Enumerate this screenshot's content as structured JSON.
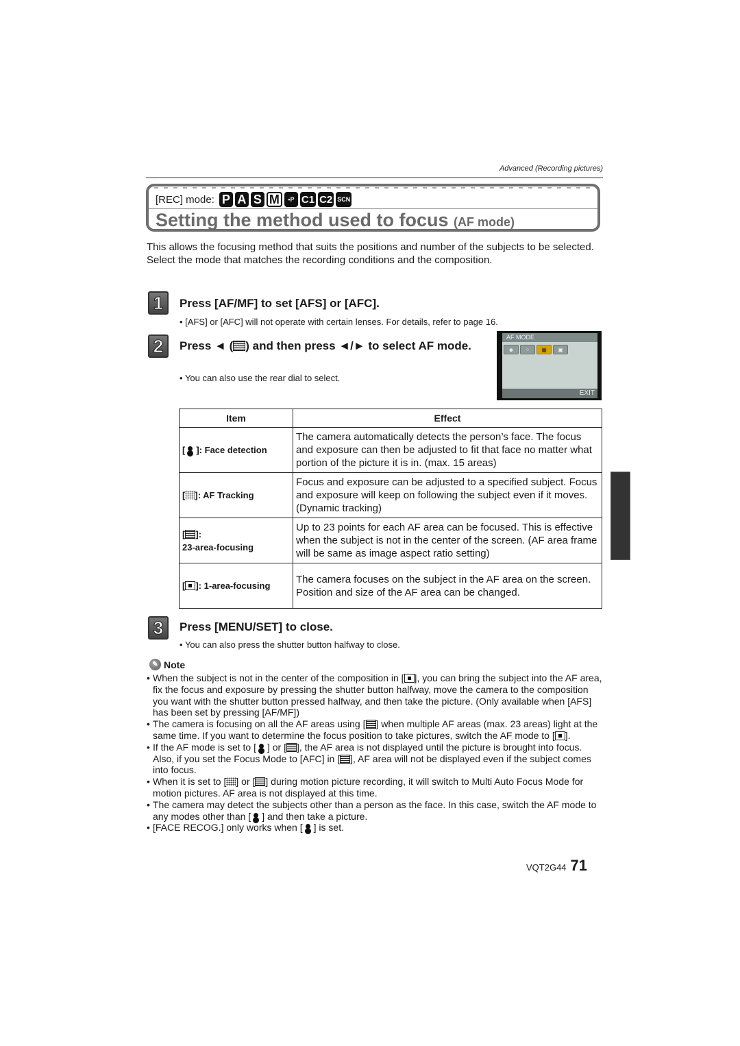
{
  "header": {
    "section_label": "Advanced (Recording pictures)"
  },
  "title_box": {
    "rec_mode_label": "[REC] mode:",
    "rec_modes": [
      "P",
      "A",
      "S",
      "M",
      "movie-P",
      "C1",
      "C2",
      "SCN"
    ],
    "title": "Setting the method used to focus",
    "title_sub": "(AF mode)"
  },
  "intro": {
    "paragraph_1": "This allows the focusing method that suits the positions and number of the subjects to be selected.",
    "paragraph_2": "Select the mode that matches the recording conditions and the composition."
  },
  "steps": [
    {
      "number": "1",
      "heading": "Press [AF/MF] to set [AFS] or [AFC].",
      "bullet": "[AFS] or [AFC] will not operate with certain lenses. For details, refer to page 16."
    },
    {
      "number": "2",
      "heading_part1": "Press ◄ (",
      "heading_icon": "af-mode-icon",
      "heading_part2": ") and then press ◄/► to select AF mode.",
      "bullet": "You can also use the rear dial to select."
    },
    {
      "number": "3",
      "heading": "Press [MENU/SET] to close.",
      "bullet": "You can also press the shutter button halfway to close."
    }
  ],
  "camera_screen": {
    "title": "AF MODE",
    "icons": [
      "face-detection",
      "af-tracking",
      "23-area-focusing",
      "1-area-focusing"
    ],
    "selected_index": 2,
    "exit_label": "EXIT"
  },
  "table": {
    "headers": [
      "Item",
      "Effect"
    ],
    "rows": [
      {
        "icon": "face-detection-icon",
        "item": ": Face detection",
        "effect": "The camera automatically detects the person’s face. The focus and exposure can then be adjusted to fit that face no matter what portion of the picture it is in. (max. 15 areas)"
      },
      {
        "icon": "af-tracking-icon",
        "item": ": AF Tracking",
        "effect": "Focus and exposure can be adjusted to a specified subject. Focus and exposure will keep on following the subject even if it moves. (Dynamic tracking)"
      },
      {
        "icon": "23-area-icon",
        "item": ":",
        "item_line2": "23-area-focusing",
        "effect": "Up to 23 points for each AF area can be focused. This is effective when the subject is not in the center of the screen. (AF area frame will be same as image aspect ratio setting)"
      },
      {
        "icon": "1-area-icon",
        "item": ": 1-area-focusing",
        "effect_line1": "The camera focuses on the subject in the AF area on the screen.",
        "effect_line2": "Position and size of the AF area can be changed."
      }
    ]
  },
  "note": {
    "heading": "Note",
    "items": [
      {
        "parts": [
          "When the subject is not in the center of the composition in [",
          "]",
          ", you can bring the subject into the AF area, fix the focus and exposure by pressing the shutter button halfway, move the camera to the composition you want with the shutter button pressed halfway, and then take the picture. (Only available when [AFS] has been set by pressing [AF/MF])"
        ]
      },
      {
        "parts": [
          "The camera is focusing on all the AF areas using [",
          "] when multiple AF areas (max. 23 areas) light at the same time. If you want to determine the focus position to take pictures, switch the AF mode to [",
          "]."
        ]
      },
      {
        "parts": [
          "If the AF mode is set to [",
          "] or [",
          "], the AF area is not displayed until the picture is brought into focus. Also, if you set the Focus Mode to [AFC] in [",
          "], AF area will not be displayed even if the subject comes into focus."
        ]
      },
      {
        "parts": [
          "When it is set to [",
          "] or [",
          "] during motion picture recording, it will switch to Multi Auto Focus Mode for motion pictures. AF area is not displayed at this time."
        ]
      },
      {
        "parts": [
          "The camera may detect the subjects other than a person as the face. In this case, switch the AF mode to any modes other than [",
          "] and then take a picture."
        ]
      },
      {
        "parts": [
          "[FACE RECOG.] only works when [",
          "] is set."
        ]
      }
    ]
  },
  "footer": {
    "model_code": "VQT2G44",
    "page_number": "71"
  }
}
